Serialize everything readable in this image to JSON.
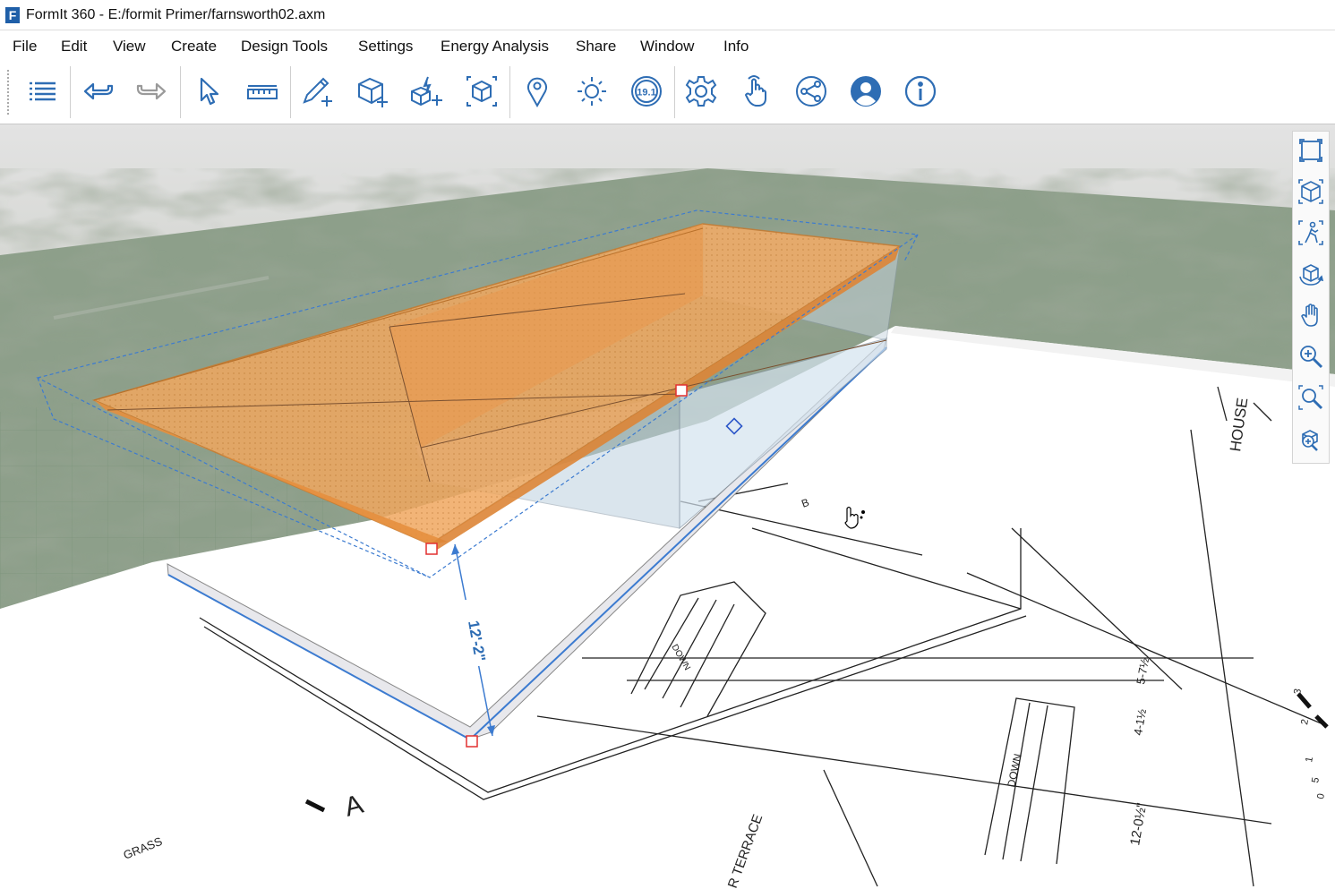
{
  "window": {
    "title": "FormIt 360 - E:/formit Primer/farnsworth02.axm",
    "app_icon_letter": "F"
  },
  "menu": {
    "items": [
      {
        "label": "File"
      },
      {
        "label": "Edit"
      },
      {
        "label": "View"
      },
      {
        "label": "Create"
      },
      {
        "label": "Design Tools"
      },
      {
        "label": "Settings"
      },
      {
        "label": "Energy Analysis"
      },
      {
        "label": "Share"
      },
      {
        "label": "Window"
      },
      {
        "label": "Info"
      }
    ]
  },
  "toolbar": {
    "icon_color": "#2e6db4",
    "buttons": [
      {
        "icon": "layers-list-icon"
      },
      {
        "icon": "undo-icon"
      },
      {
        "icon": "redo-icon"
      },
      {
        "icon": "select-cursor-icon"
      },
      {
        "icon": "measure-tape-icon"
      },
      {
        "icon": "sketch-pencil-icon"
      },
      {
        "icon": "add-solid-icon"
      },
      {
        "icon": "solid-tools-icon"
      },
      {
        "icon": "group-icon"
      },
      {
        "icon": "location-pin-icon"
      },
      {
        "icon": "sun-shadow-icon"
      },
      {
        "icon": "level-icon",
        "text": "19.1"
      },
      {
        "icon": "settings-gear-icon"
      },
      {
        "icon": "gesture-hand-icon"
      },
      {
        "icon": "share-icon"
      },
      {
        "icon": "user-profile-icon"
      },
      {
        "icon": "info-icon"
      }
    ]
  },
  "viewport": {
    "dimension_label": "12'-2\"",
    "selection_color": "#f0a860",
    "sky_color": "#e6e6e6",
    "ground_color": "#8a9e88",
    "drawing_labels": {
      "grass": "GRASS",
      "section_a": "A",
      "section_b": "B",
      "down_1": "DOWN",
      "down_2": "DOWN",
      "terrace": "R TERRACE",
      "house": "HOUSE",
      "dim_1": "5-7½",
      "dim_2": "4-1½",
      "dim_3": "12-0½\"",
      "scale_1": "3",
      "scale_2": "2",
      "scale_3": "0",
      "scale_4": "5",
      "scale_5": "1"
    }
  },
  "nav": {
    "buttons": [
      {
        "icon": "zoom-extents-icon"
      },
      {
        "icon": "view-cube-icon"
      },
      {
        "icon": "walk-through-icon"
      },
      {
        "icon": "orbit-icon"
      },
      {
        "icon": "pan-hand-icon"
      },
      {
        "icon": "zoom-icon"
      },
      {
        "icon": "zoom-window-icon"
      },
      {
        "icon": "zoom-selection-icon"
      }
    ]
  }
}
